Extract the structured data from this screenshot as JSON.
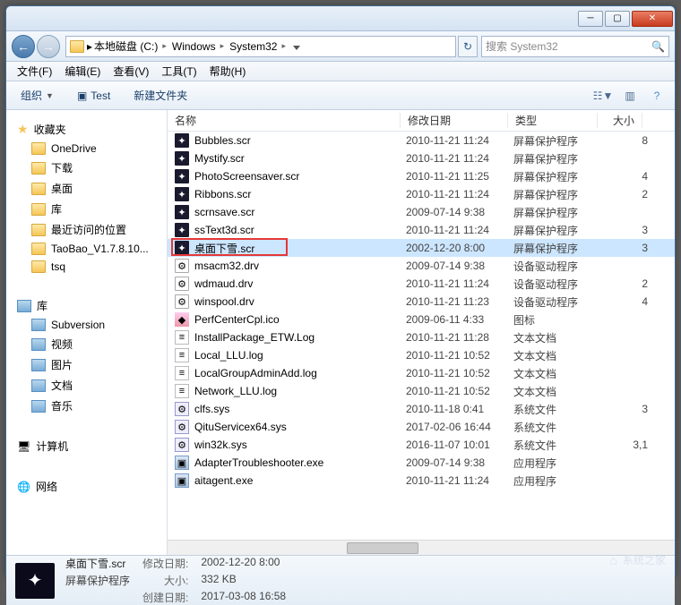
{
  "titlebar": {
    "min": "─",
    "max": "▢",
    "close": "✕"
  },
  "nav": {
    "back": "←",
    "fwd": "→",
    "crumbs": [
      "本地磁盘 (C:)",
      "Windows",
      "System32"
    ],
    "search_placeholder": "搜索 System32",
    "refresh": "↻"
  },
  "menu": [
    "文件(F)",
    "编辑(E)",
    "查看(V)",
    "工具(T)",
    "帮助(H)"
  ],
  "toolbar": {
    "org": "组织",
    "test": "Test",
    "newfolder": "新建文件夹"
  },
  "sidebar": {
    "fav_label": "收藏夹",
    "fav": [
      "OneDrive",
      "下载",
      "桌面",
      "库",
      "最近访问的位置",
      "TaoBao_V1.7.8.10...",
      "tsq"
    ],
    "lib_label": "库",
    "lib": [
      "Subversion",
      "视频",
      "图片",
      "文档",
      "音乐"
    ],
    "computer_label": "计算机",
    "network_label": "网络"
  },
  "cols": {
    "name": "名称",
    "date": "修改日期",
    "type": "类型",
    "size": "大小"
  },
  "files": [
    {
      "n": "Bubbles.scr",
      "d": "2010-11-21 11:24",
      "t": "屏幕保护程序",
      "s": "8",
      "k": "scr"
    },
    {
      "n": "Mystify.scr",
      "d": "2010-11-21 11:24",
      "t": "屏幕保护程序",
      "s": "",
      "k": "scr"
    },
    {
      "n": "PhotoScreensaver.scr",
      "d": "2010-11-21 11:25",
      "t": "屏幕保护程序",
      "s": "4",
      "k": "scr"
    },
    {
      "n": "Ribbons.scr",
      "d": "2010-11-21 11:24",
      "t": "屏幕保护程序",
      "s": "2",
      "k": "scr"
    },
    {
      "n": "scrnsave.scr",
      "d": "2009-07-14 9:38",
      "t": "屏幕保护程序",
      "s": "",
      "k": "scr"
    },
    {
      "n": "ssText3d.scr",
      "d": "2010-11-21 11:24",
      "t": "屏幕保护程序",
      "s": "3",
      "k": "scr"
    },
    {
      "n": "桌面下雪.scr",
      "d": "2002-12-20 8:00",
      "t": "屏幕保护程序",
      "s": "3",
      "k": "scr",
      "sel": true,
      "hl": true
    },
    {
      "n": "msacm32.drv",
      "d": "2009-07-14 9:38",
      "t": "设备驱动程序",
      "s": "",
      "k": "drv"
    },
    {
      "n": "wdmaud.drv",
      "d": "2010-11-21 11:24",
      "t": "设备驱动程序",
      "s": "2",
      "k": "drv"
    },
    {
      "n": "winspool.drv",
      "d": "2010-11-21 11:23",
      "t": "设备驱动程序",
      "s": "4",
      "k": "drv"
    },
    {
      "n": "PerfCenterCpl.ico",
      "d": "2009-06-11 4:33",
      "t": "图标",
      "s": "",
      "k": "ico"
    },
    {
      "n": "InstallPackage_ETW.Log",
      "d": "2010-11-21 11:28",
      "t": "文本文档",
      "s": "",
      "k": "txt"
    },
    {
      "n": "Local_LLU.log",
      "d": "2010-11-21 10:52",
      "t": "文本文档",
      "s": "",
      "k": "txt"
    },
    {
      "n": "LocalGroupAdminAdd.log",
      "d": "2010-11-21 10:52",
      "t": "文本文档",
      "s": "",
      "k": "txt"
    },
    {
      "n": "Network_LLU.log",
      "d": "2010-11-21 10:52",
      "t": "文本文档",
      "s": "",
      "k": "txt"
    },
    {
      "n": "clfs.sys",
      "d": "2010-11-18 0:41",
      "t": "系统文件",
      "s": "3",
      "k": "sys"
    },
    {
      "n": "QituServicex64.sys",
      "d": "2017-02-06 16:44",
      "t": "系统文件",
      "s": "",
      "k": "sys"
    },
    {
      "n": "win32k.sys",
      "d": "2016-11-07 10:01",
      "t": "系统文件",
      "s": "3,1",
      "k": "sys"
    },
    {
      "n": "AdapterTroubleshooter.exe",
      "d": "2009-07-14 9:38",
      "t": "应用程序",
      "s": "",
      "k": "exe"
    },
    {
      "n": "aitagent.exe",
      "d": "2010-11-21 11:24",
      "t": "应用程序",
      "s": "",
      "k": "exe"
    }
  ],
  "status": {
    "filename": "桌面下雪.scr",
    "filetype": "屏幕保护程序",
    "mod_label": "修改日期:",
    "mod": "2002-12-20 8:00",
    "create_label": "创建日期:",
    "create": "2017-03-08 16:58",
    "size_label": "大小:",
    "size": "332 KB"
  },
  "watermark": "系统之家"
}
